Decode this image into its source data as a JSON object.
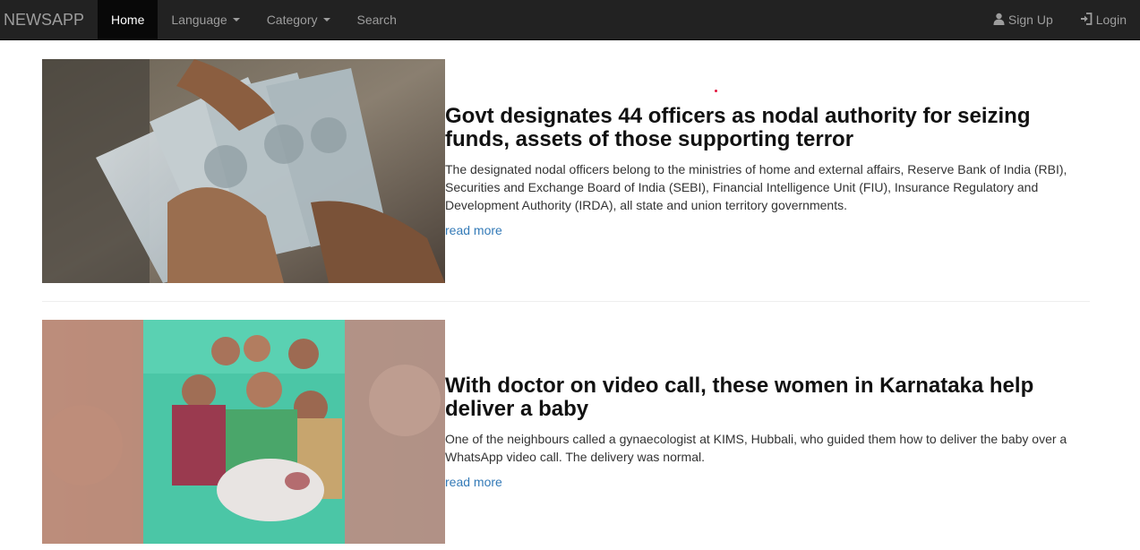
{
  "nav": {
    "brand": "NEWSAPP",
    "items": [
      {
        "label": "Home",
        "active": true
      },
      {
        "label": "Language",
        "dropdown": true
      },
      {
        "label": "Category",
        "dropdown": true
      },
      {
        "label": "Search"
      }
    ],
    "signup_label": "Sign Up",
    "login_label": "Login",
    "signup_icon": "user-icon",
    "login_icon": "login-icon"
  },
  "articles": [
    {
      "title": "Govt designates 44 officers as nodal authority for seizing funds, assets of those supporting terror",
      "description": "The designated nodal officers belong to the ministries of home and external affairs, Reserve Bank of India (RBI), Securities and Exchange Board of India (SEBI), Financial Intelligence Unit (FIU), Insurance Regulatory and Development Authority (IRDA), all state and union territory governments.",
      "read_more": "read more",
      "image": "currency-notes-image"
    },
    {
      "title": "With doctor on video call, these women in Karnataka help deliver a baby",
      "description": "One of the neighbours called a gynaecologist at KIMS, Hubbali, who guided them how to deliver the baby over a WhatsApp video call. The delivery was normal.",
      "read_more": "read more",
      "image": "women-with-newborn-image"
    }
  ],
  "colors": {
    "navbar_bg": "#222222",
    "nav_active_bg": "#080808",
    "nav_text": "#9d9d9d",
    "link": "#337ab7"
  }
}
